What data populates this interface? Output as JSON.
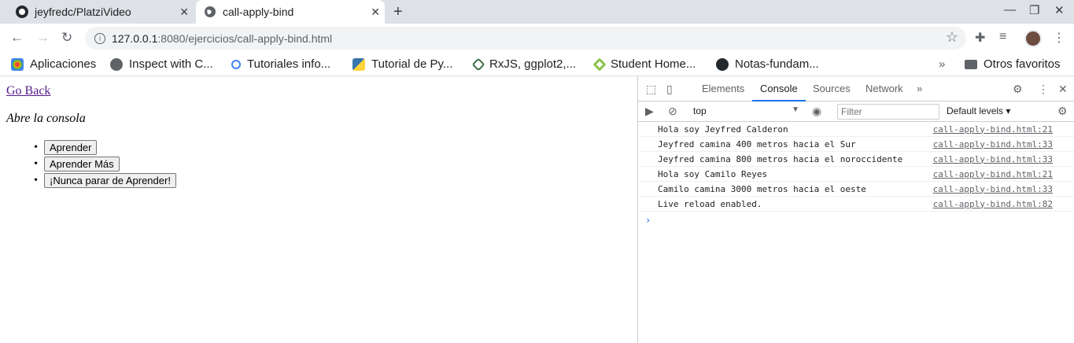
{
  "browser": {
    "tabs": [
      {
        "title": "jeyfredc/PlatziVideo",
        "icon": "github-icon"
      },
      {
        "title": "call-apply-bind",
        "icon": "globe-icon",
        "active": true
      }
    ],
    "address": {
      "host": "127.0.0.1",
      "rest": ":8080/ejercicios/call-apply-bind.html"
    },
    "bookmarks": [
      {
        "label": "Aplicaciones",
        "icon": "apps-grid-icon"
      },
      {
        "label": "Inspect with C...",
        "icon": "globe-icon"
      },
      {
        "label": "Tutoriales info...",
        "icon": "search-icon"
      },
      {
        "label": "Tutorial de Py...",
        "icon": "python-icon"
      },
      {
        "label": "RxJS, ggplot2,...",
        "icon": "diamond-icon"
      },
      {
        "label": "Student Home...",
        "icon": "leaf-icon"
      },
      {
        "label": "Notas-fundam...",
        "icon": "github-icon"
      }
    ],
    "bookmarks_more": "»",
    "other_bookmarks": "Otros favoritos"
  },
  "page": {
    "back_link": "Go Back",
    "hint": "Abre la consola",
    "buttons": [
      "Aprender",
      "Aprender Más",
      "¡Nunca parar de Aprender!"
    ]
  },
  "devtools": {
    "tabs": [
      "Elements",
      "Console",
      "Sources",
      "Network"
    ],
    "active_tab": "Console",
    "more": "»",
    "context": "top",
    "filter_placeholder": "Filter",
    "levels": "Default levels ▾",
    "messages": [
      {
        "text": "Hola soy Jeyfred Calderon",
        "source": "call-apply-bind.html:21"
      },
      {
        "text": "Jeyfred camina 400 metros hacia el Sur",
        "source": "call-apply-bind.html:33"
      },
      {
        "text": "Jeyfred camina 800 metros hacia el noroccidente",
        "source": "call-apply-bind.html:33"
      },
      {
        "text": "Hola soy Camilo Reyes",
        "source": "call-apply-bind.html:21"
      },
      {
        "text": "Camilo camina 3000 metros hacia el oeste",
        "source": "call-apply-bind.html:33"
      },
      {
        "text": "Live reload enabled.",
        "source": "call-apply-bind.html:82"
      }
    ],
    "prompt": "›"
  },
  "colors": {
    "accent": "#1a73e8",
    "visited_link": "#551a8b",
    "tabstrip": "#dee1e6"
  }
}
